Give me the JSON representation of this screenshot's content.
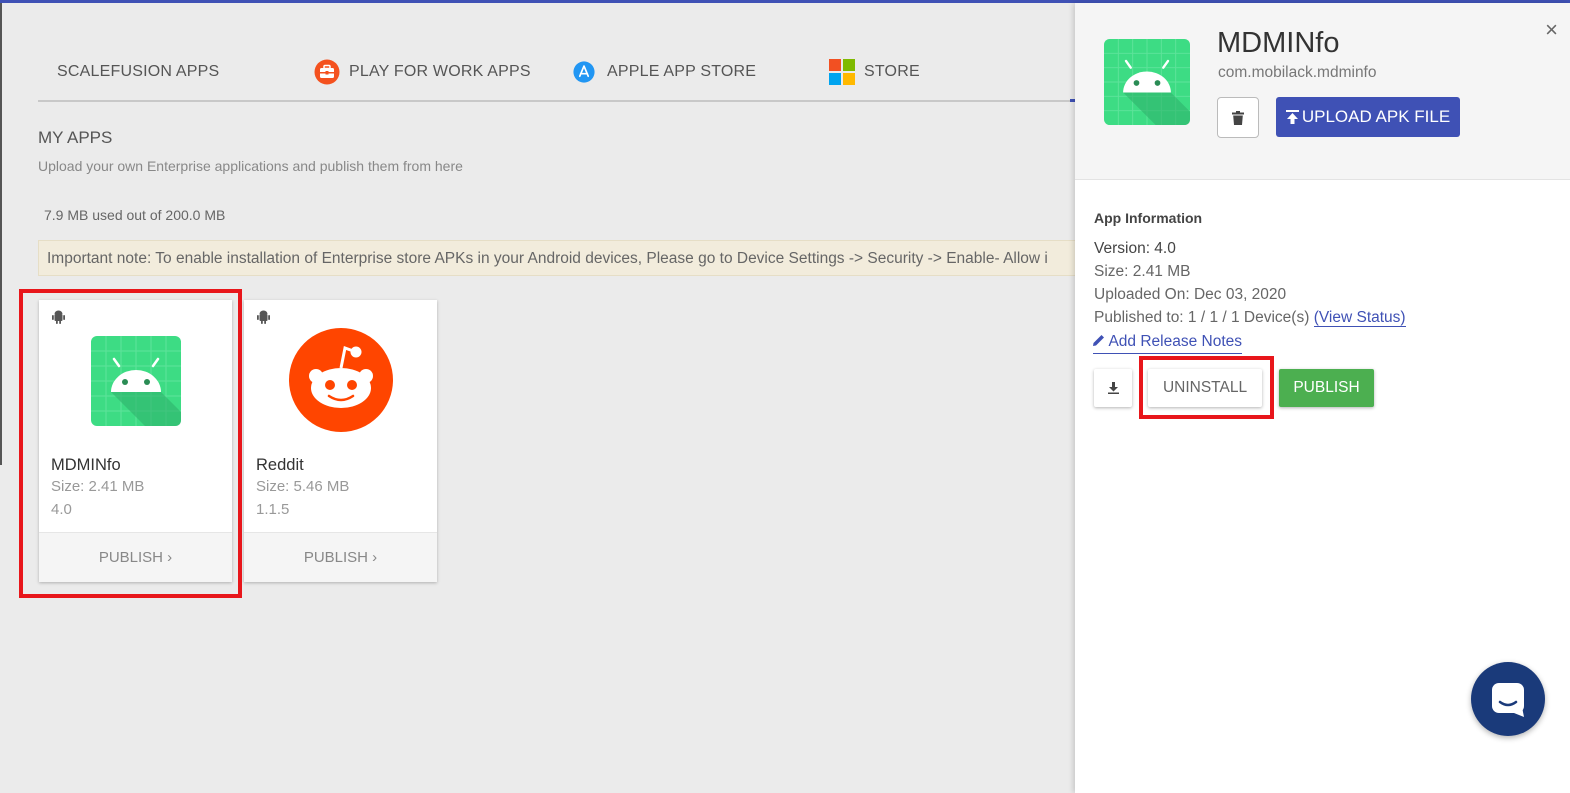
{
  "tabs": [
    {
      "label": "SCALEFUSION APPS",
      "icon": "none"
    },
    {
      "label": "PLAY FOR WORK APPS",
      "icon": "briefcase-icon"
    },
    {
      "label": "APPLE APP STORE",
      "icon": "app-store-icon"
    },
    {
      "label": "STORE",
      "icon": "windows-icon"
    }
  ],
  "my_apps": {
    "title": "MY APPS",
    "subtitle": "Upload your own Enterprise applications and publish them from here",
    "storage": "7.9 MB used out of 200.0 MB",
    "note": "Important note: To enable installation of Enterprise store APKs in your Android devices, Please go to Device Settings -> Security -> Enable- Allow i"
  },
  "apps": [
    {
      "name": "MDMINfo",
      "size": "Size: 2.41 MB",
      "version": "4.0",
      "action": "PUBLISH ›"
    },
    {
      "name": "Reddit",
      "size": "Size: 5.46 MB",
      "version": "1.1.5",
      "action": "PUBLISH ›"
    }
  ],
  "panel": {
    "title": "MDMINfo",
    "package": "com.mobilack.mdminfo",
    "upload_label": "UPLOAD APK FILE",
    "info_header": "App Information",
    "version": "Version: 4.0",
    "size": "Size: 2.41 MB",
    "uploaded": "Uploaded On: Dec 03, 2020",
    "published_prefix": "Published to: 1 / 1 / 1 Device(s)",
    "view_status": "(View Status)",
    "release_notes": "Add Release Notes",
    "uninstall": "UNINSTALL",
    "publish": "PUBLISH",
    "close": "×"
  },
  "colors": {
    "accent": "#3f51b5",
    "publish": "#4caf50",
    "highlight": "#e8161b",
    "reddit": "#ff4500",
    "android_tile": "#3ddc84",
    "chat": "#1a3a7a"
  }
}
